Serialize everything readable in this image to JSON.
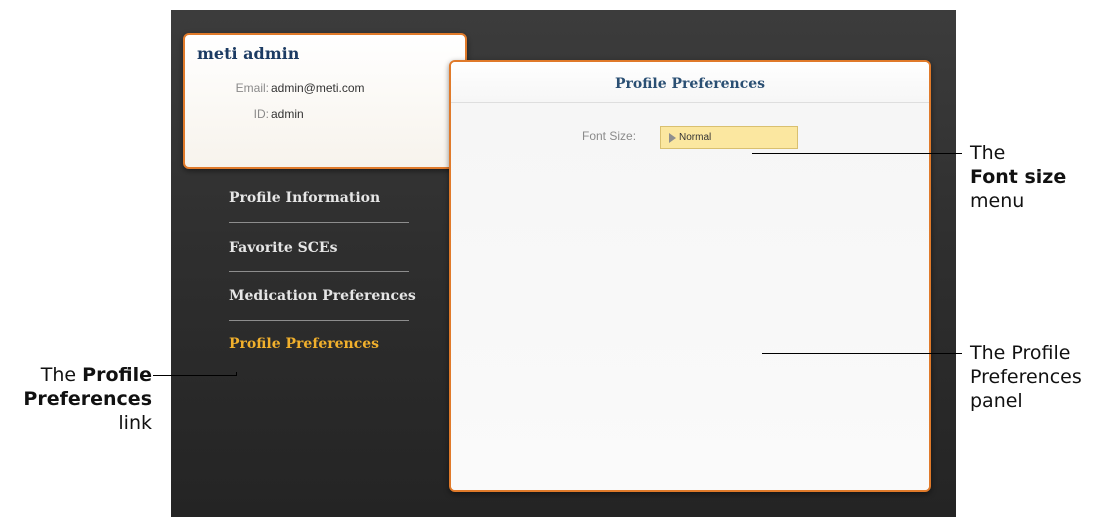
{
  "user": {
    "name": "meti admin",
    "email_label": "Email:",
    "email": "admin@meti.com",
    "id_label": "ID:",
    "id": "admin"
  },
  "nav": {
    "items": [
      {
        "label": "Profile Information"
      },
      {
        "label": "Favorite SCEs"
      },
      {
        "label": "Medication Preferences"
      },
      {
        "label": "Profile Preferences"
      }
    ]
  },
  "panel": {
    "title": "Profile Preferences",
    "font_size_label": "Font Size:",
    "font_size_value": "Normal"
  },
  "callouts": {
    "font_menu": {
      "line1": "The",
      "line2_bold": "Font size",
      "line3": "menu"
    },
    "panel": {
      "line1": "The Profile",
      "line2": "Preferences",
      "line3": "panel"
    },
    "link": {
      "line1_prefix": "The ",
      "line1_bold": "Profile",
      "line2_bold": "Preferences",
      "line3": "link"
    }
  },
  "colors": {
    "accent_orange": "#e07a2a",
    "active_nav": "#f1b02c",
    "select_bg": "#fbe7a0",
    "title_blue": "#1c3b63"
  }
}
